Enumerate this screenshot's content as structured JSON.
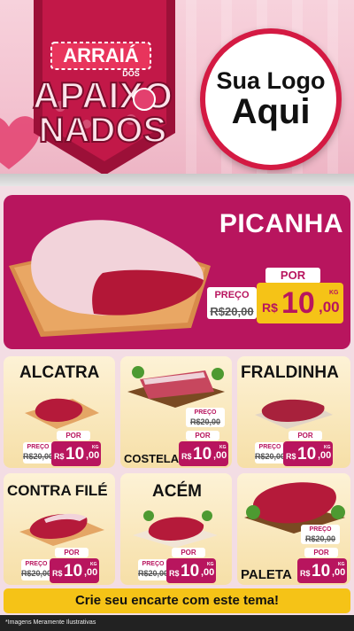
{
  "header": {
    "banner_line1": "ARRAIÁ",
    "banner_line2": "DOS",
    "banner_line3": "APAIXO",
    "banner_line4": "NADOS",
    "logo_line1": "Sua Logo",
    "logo_line2": "Aqui"
  },
  "featured": {
    "name": "PICANHA",
    "por": "POR",
    "preco_label": "PREÇO",
    "old_price": "R$20,00",
    "currency": "R$",
    "price_int": "10",
    "price_dec": ",00",
    "unit": "KG"
  },
  "products": [
    {
      "name": "ALCATRA",
      "por": "POR",
      "preco_label": "PREÇO",
      "old_price": "R$20,00",
      "currency": "R$",
      "price_int": "10",
      "price_dec": ",00",
      "unit": "KG"
    },
    {
      "name": "COSTELA",
      "por": "POR",
      "preco_label": "PREÇO",
      "old_price": "R$20,00",
      "currency": "R$",
      "price_int": "10",
      "price_dec": ",00",
      "unit": "KG"
    },
    {
      "name": "FRALDINHA",
      "por": "POR",
      "preco_label": "PREÇO",
      "old_price": "R$20,00",
      "currency": "R$",
      "price_int": "10",
      "price_dec": ",00",
      "unit": "KG"
    },
    {
      "name": "CONTRA FILÉ",
      "por": "POR",
      "preco_label": "PREÇO",
      "old_price": "R$20,00",
      "currency": "R$",
      "price_int": "10",
      "price_dec": ",00",
      "unit": "KG"
    },
    {
      "name": "ACÉM",
      "por": "POR",
      "preco_label": "PREÇO",
      "old_price": "R$20,00",
      "currency": "R$",
      "price_int": "10",
      "price_dec": ",00",
      "unit": "KG"
    },
    {
      "name": "PALETA",
      "por": "POR",
      "preco_label": "PREÇO",
      "old_price": "R$20,00",
      "currency": "R$",
      "price_int": "10",
      "price_dec": ",00",
      "unit": "KG"
    }
  ],
  "cta": "Crie seu encarte com este tema!",
  "disclaimer": "*Imagens Meramente Ilustrativas",
  "colors": {
    "brand": "#b8155e",
    "accent": "#f5c317",
    "card": "#fdf2d6"
  }
}
